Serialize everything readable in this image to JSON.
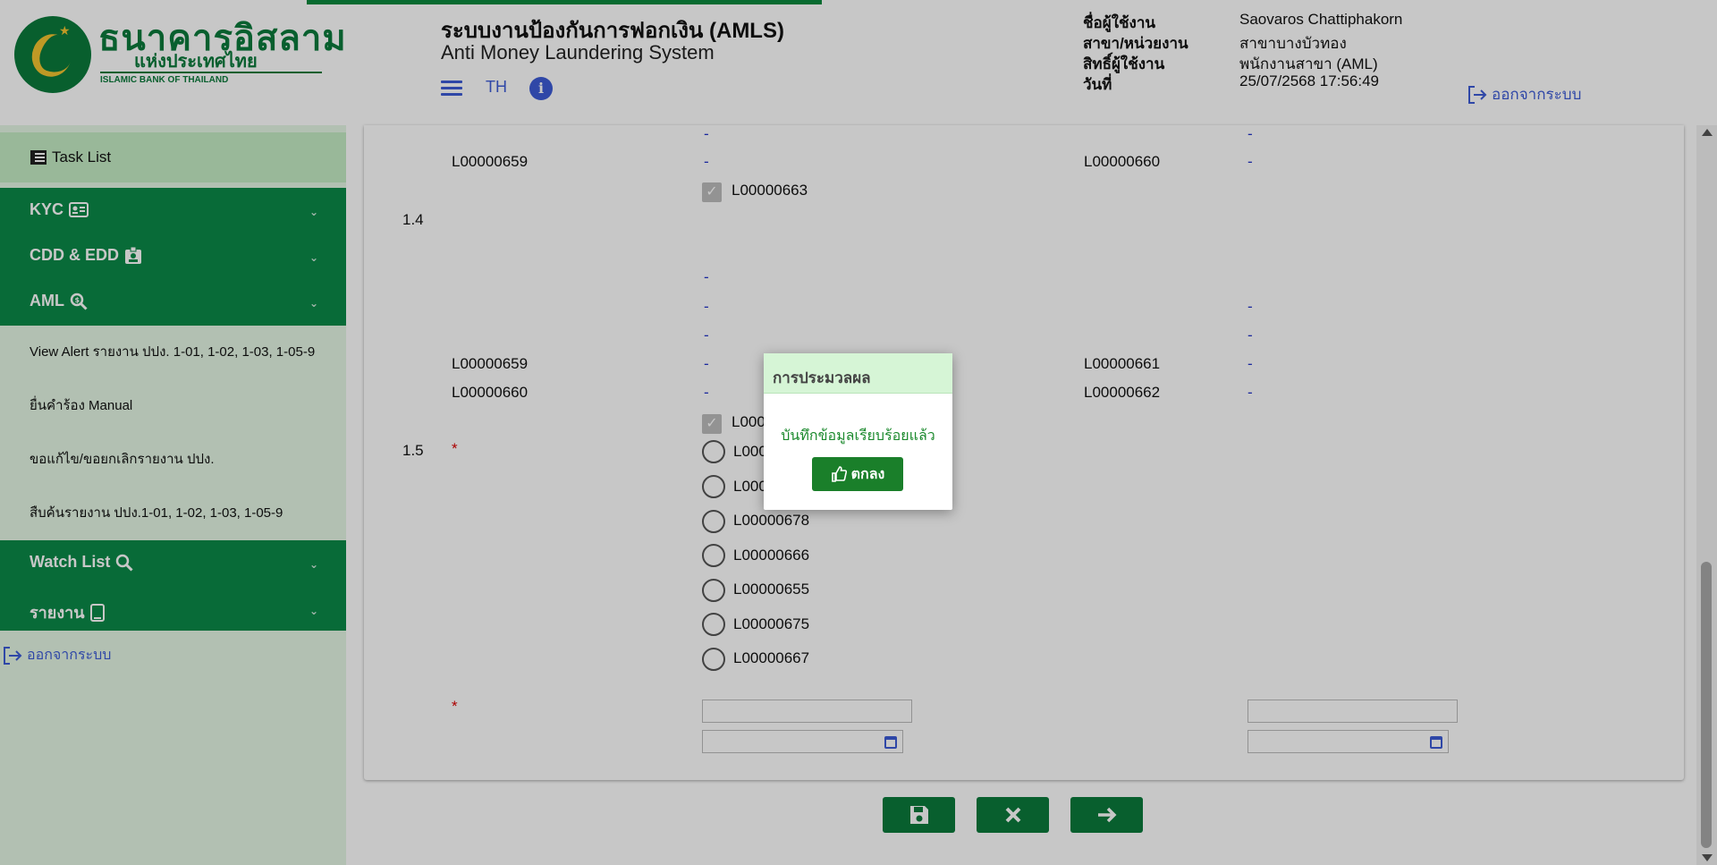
{
  "header": {
    "bank_name_th": "ธนาคารอิสลาม",
    "bank_name_th_2": "แห่งประเทศไทย",
    "bank_name_en": "ISLAMIC BANK OF THAILAND",
    "title": "ระบบงานป้องกันการฟอกเงิน (AMLS)",
    "subtitle": "Anti Money Laundering System",
    "lang": "TH",
    "info": "i",
    "logout": "ออกจากระบบ",
    "user": {
      "name_label": "ชื่อผู้ใช้งาน",
      "name": "Saovaros Chattiphakorn",
      "branch_label": "สาขา/หน่วยงาน",
      "branch": "สาขาบางบัวทอง",
      "role_label": "สิทธิ์ผู้ใช้งาน",
      "role": "พนักงานสาขา (AML)",
      "date_label": "วันที่",
      "date": "25/07/2568 17:56:49"
    }
  },
  "sidebar": {
    "task_list": "Task List",
    "sections": [
      {
        "label": "KYC",
        "icon": "id-card-icon"
      },
      {
        "label": "CDD & EDD",
        "icon": "id-badge-icon"
      },
      {
        "label": "AML",
        "icon": "search-dollar-icon"
      }
    ],
    "aml_items": [
      "View Alert รายงาน ปปง. 1-01, 1-02, 1-03, 1-05-9",
      "ยื่นคำร้อง Manual",
      "ขอแก้ไข/ขอยกเลิกรายงาน ปปง.",
      "สืบค้นรายงาน ปปง.1-01, 1-02, 1-03, 1-05-9"
    ],
    "sections2": [
      {
        "label": "Watch List",
        "icon": "search-icon"
      },
      {
        "label": "รายงาน",
        "icon": "tablet-icon"
      }
    ],
    "logout": "ออกจากระบบ"
  },
  "form": {
    "dash": "-",
    "required": "*",
    "row_a": {
      "left_code": "L00000659",
      "right_code": "L00000660",
      "checked_code": "L00000663"
    },
    "section_14": "1.4",
    "row_b": [
      {
        "left": "L00000659",
        "right": "L00000661"
      },
      {
        "left": "L00000660",
        "right": "L00000662"
      }
    ],
    "checked_code_b": "L00000664",
    "section_15": "1.5",
    "radio_options": [
      "L00000665",
      "L00000677",
      "L00000678",
      "L00000666",
      "L00000655",
      "L00000675",
      "L00000667"
    ]
  },
  "modal": {
    "title": "การประมวลผล",
    "message": "บันทึกข้อมูลเรียบร้อยแล้ว",
    "ok_label": "ตกลง"
  },
  "colors": {
    "brand_green": "#0b8a48",
    "accent_blue": "#3d5bd6",
    "dash_blue": "#2033c9"
  }
}
